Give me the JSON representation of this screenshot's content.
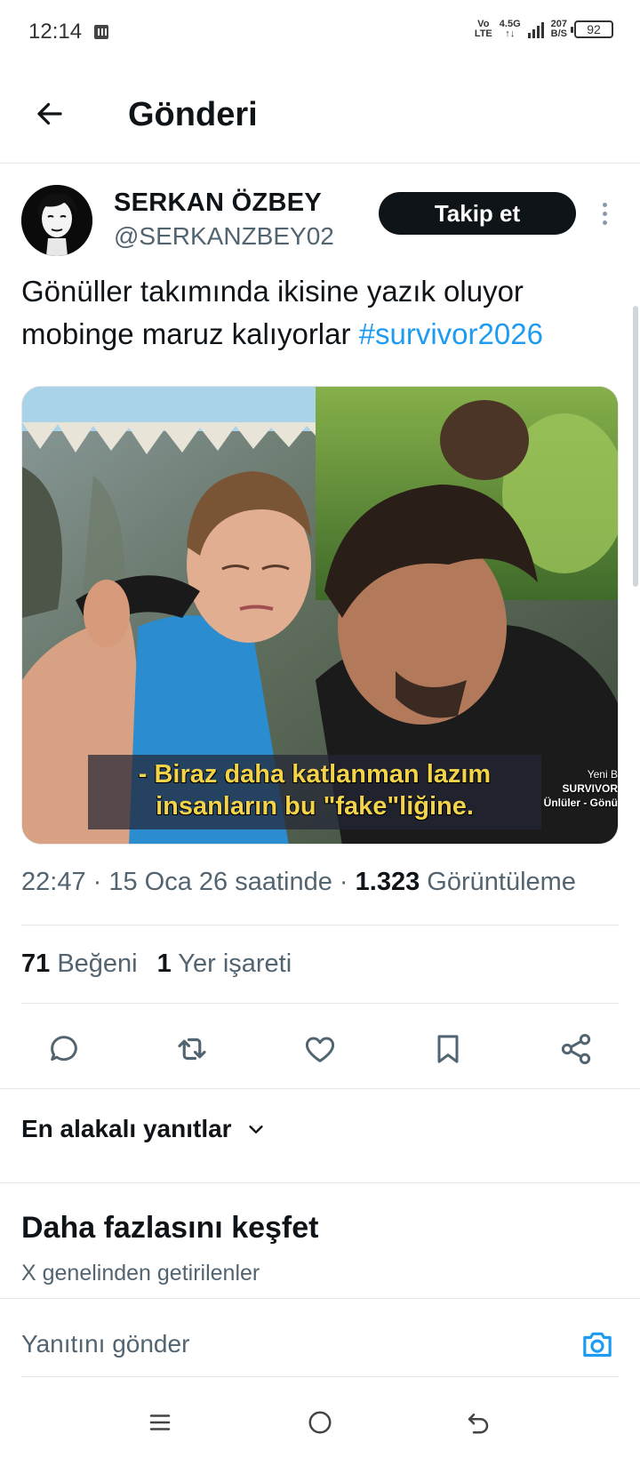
{
  "status_bar": {
    "time": "12:14",
    "net_volte_top": "Vo",
    "net_volte_bottom": "LTE",
    "net_gen": "4.5G",
    "net_arrows": "↑↓",
    "speed_value": "207",
    "speed_unit": "B/S",
    "battery": "92"
  },
  "header": {
    "back_icon": "arrow-left-icon",
    "title": "Gönderi"
  },
  "post": {
    "author_name": "SERKAN ÖZBEY",
    "author_handle": "@SERKANZBEY02",
    "follow_label": "Takip et",
    "text_part1": "Gönüller takımında ikisine yazık oluyor mobinge maruz kalıyorlar ",
    "hashtag": "#survivor2026",
    "media": {
      "subtitle_line1": "- Biraz daha katlanman lazım",
      "subtitle_line2": "insanların bu \"fake\"liğine.",
      "watermark_line1": "Yeni B",
      "watermark_line2": "SURVIVOR",
      "watermark_line3": "Ünlüler - Gönü"
    },
    "time": "22:47",
    "sep1": " · ",
    "date": "15 Oca 26 saatinde",
    "sep2": " · ",
    "views_count": "1.323",
    "views_label": " Görüntüleme",
    "likes_count": "71",
    "likes_label": " Beğeni",
    "bookmarks_count": "1",
    "bookmarks_label": " Yer işareti"
  },
  "actions": [
    {
      "icon": "reply-icon"
    },
    {
      "icon": "retweet-icon"
    },
    {
      "icon": "like-icon"
    },
    {
      "icon": "bookmark-icon"
    },
    {
      "icon": "share-icon"
    }
  ],
  "replies": {
    "sort_label": "En alakalı yanıtlar",
    "sort_icon": "chevron-down-icon"
  },
  "discover": {
    "title": "Daha fazlasını keşfet",
    "subtitle": "X genelinden getirilenler"
  },
  "composer": {
    "placeholder": "Yanıtını gönder",
    "camera_icon": "camera-icon"
  },
  "colors": {
    "accent": "#1d9bf0",
    "text_primary": "#0f1419",
    "text_secondary": "#536471",
    "follow_bg": "#0f1419",
    "subtitle_yellow": "#f3d34a"
  }
}
